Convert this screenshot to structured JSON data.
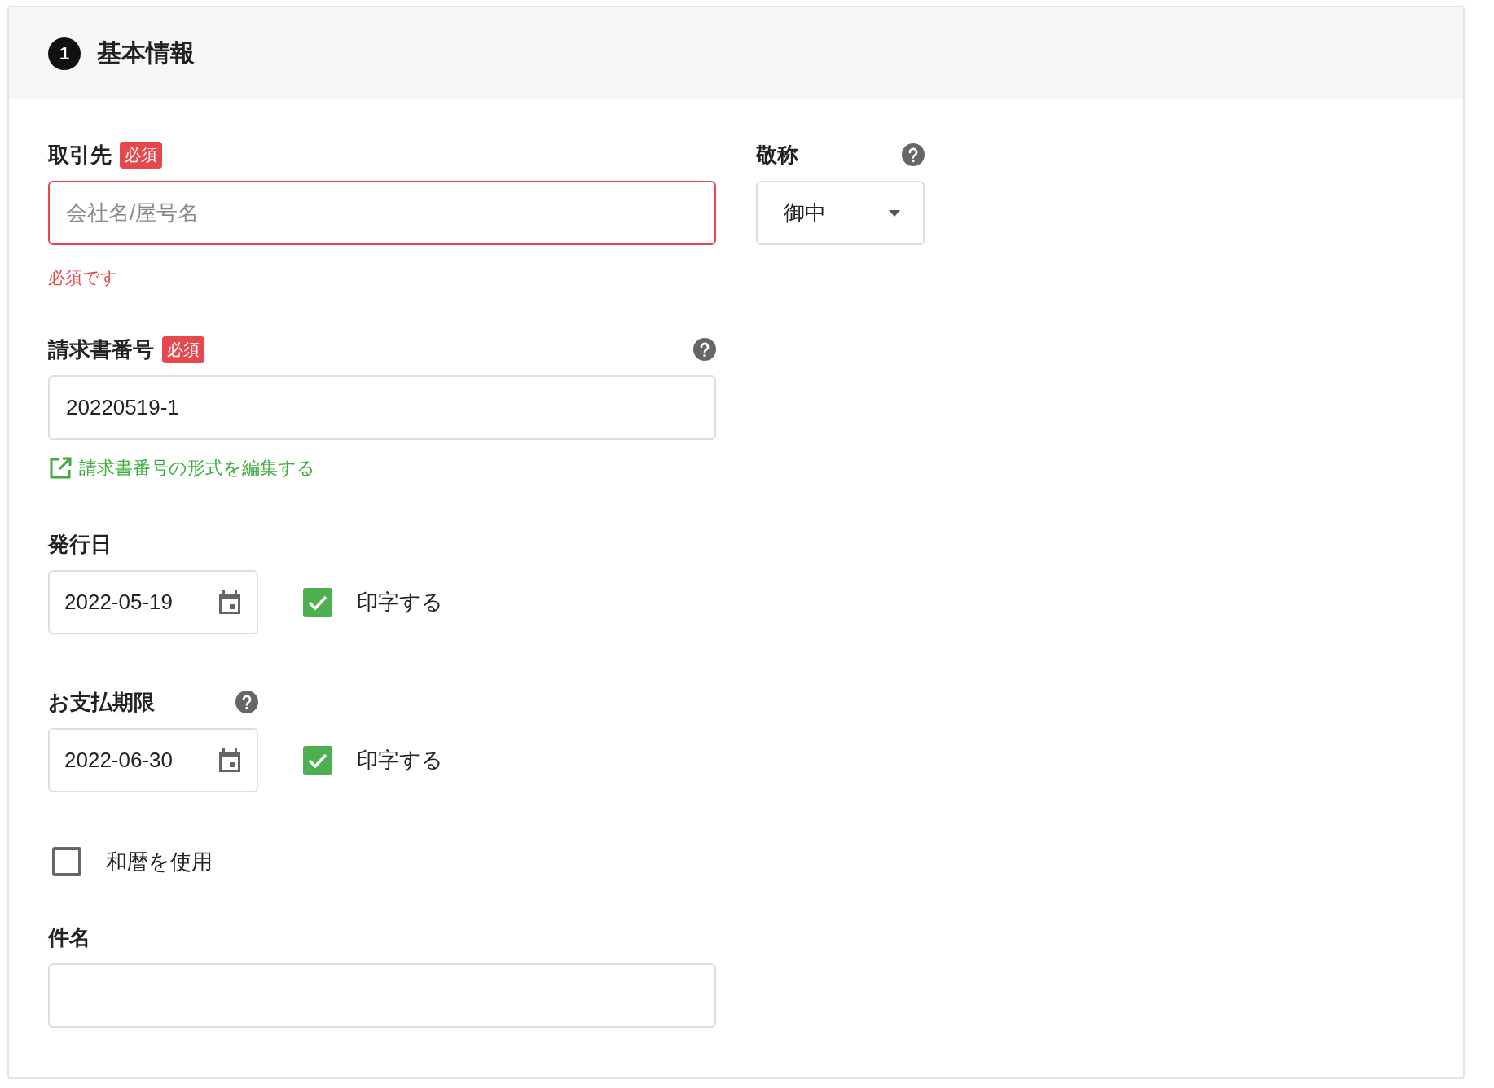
{
  "section": {
    "number": "1",
    "title": "基本情報"
  },
  "client": {
    "label": "取引先",
    "required_badge": "必須",
    "placeholder": "会社名/屋号名",
    "invalid": true,
    "error": "必須です"
  },
  "honorific": {
    "label": "敬称",
    "help": true,
    "value": "御中"
  },
  "invoice_number": {
    "label": "請求書番号",
    "required_badge": "必須",
    "help": true,
    "value": "20220519-1",
    "link": "請求書番号の形式を編集する"
  },
  "issue_date": {
    "label": "発行日",
    "value": "2022-05-19",
    "print": {
      "label": "印字する",
      "checked": true
    }
  },
  "due_date": {
    "label": "お支払期限",
    "help": true,
    "value": "2022-06-30",
    "print": {
      "label": "印字する",
      "checked": true
    }
  },
  "japanese_era": {
    "label": "和暦を使用",
    "checked": false
  },
  "subject": {
    "label": "件名"
  }
}
